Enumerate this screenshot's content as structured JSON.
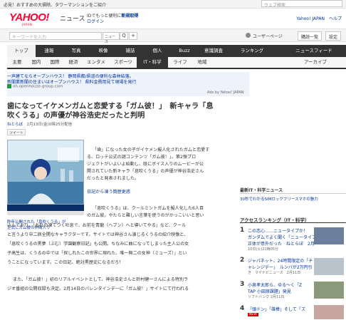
{
  "topbar": {
    "promo": "必見！おすすめの大掃除、タワーマンションをご紹介",
    "search_placeholder": "ウェブ検索"
  },
  "header": {
    "logo": "YAHOO!",
    "logo_sub": "JAPAN",
    "news": "ニュース",
    "login_line1_a": "IDでもっと便利に",
    "login_line1_b": "新規取得",
    "login_line2": "ログイン",
    "right_links": "Yahoo! JAPAN　ヘルプ"
  },
  "searchbar": {
    "keyword_placeholder": "キーワードを入力",
    "category": "ニュース",
    "search_btn": "Q",
    "add_btn": "+",
    "user_page": "ユーザーページ",
    "btn1": "購読一覧",
    "btn2": "設定"
  },
  "nav": {
    "items": [
      "トップ",
      "速報",
      "写真",
      "映像",
      "雑誌",
      "個人",
      "Buzz",
      "意識調査",
      "ランキング",
      "ニュースフィード"
    ]
  },
  "subnav": {
    "items": [
      "主要",
      "国内",
      "国際",
      "経済",
      "エンタメ",
      "スポーツ",
      "IT・科学",
      "ライフ",
      "地域",
      "アーカイブ"
    ]
  },
  "ad": {
    "line1": "一声建てならオープンハウス！ 静岡県都/県道の便利な森林結落。",
    "line2": "新聞業新聞の住まいはオープンハウス！ 県料金費用見て現場を発行",
    "line3": "oh.openhouse-group.com",
    "by": "Ads by Yahoo! JAPAN"
  },
  "article": {
    "title_line1": "歯になってイケメンガムと恋愛する「ガム彼！」　新キャラ「息",
    "title_line2": "吹くうる」の声優が神谷浩史だったと判明",
    "source": "ねとらぼ",
    "date": "2月13日(金)0時25分配信",
    "social_btn": "ツイート",
    "photo_caption1": "昨年公開された「息吹くうる」が",
    "photo_caption2": "正式にガム彼の仲間入り",
    "p1_lines": [
      "「歯」になった女の子がイケメン擬人化されたガムと恋愛す",
      "る、ロッテ公式の謎コンテンツ「ガム彼！」。第2弾プロ",
      "ジェクトがいよいよ始動し、既にボイス入りのムービーが公",
      "開されていた新キャラ「息吹くうる」の声優が神谷浩史さん",
      "だったと発表されました。"
    ],
    "p1_link": "日記から凍う簡歴更惑",
    "p2_lines": [
      "「息吹くうる」は、クールミントガムを擬人化した6人目",
      "のガム彼。やたらと難しい言葉を使うのがかっこいいと思い",
      "込んでおり、「おれの凍てつく吐息で、お前を青龍（ヘブン）へと導いてやる」など、クール",
      "と言うより中二病全開なキャラクターです。サイトでは神谷さん演じるくうるの紹介映像と、",
      "「息吹くうるの黒夢（ぶむ）学園観察日記」も公開。ちなみに曲になってしまった主人公の女",
      "子高生は、くうるの中では「探しれたこの世界に現れた、唯一無二の女神（ミューズ）」とい",
      "うことになっています。この日記、絶対黒歴史になるだろ！"
    ],
    "p3_lines": [
      "また、「ガム彼！」初のリアルイベントとして、神谷浩史さんと鈴村健一さんによる特別ラ",
      "ジオ番組の公開収録も決定。2月14日のバレンタインデーに「ガム彼！」サイトにて行われる"
    ]
  },
  "right": {
    "latest_title": "最新IT・科学ニュース",
    "latest_item": "30秒でわかるSIMロックフリースマホの魅力",
    "ranking_title": "アクセスランキング（IT・科学）",
    "items": [
      {
        "num": "1",
        "lines": [
          "この恋心……ニュータイプか！",
          "ガンダムでよく聞く「ニュータイプ」の",
          "正体が意外だった　ねとらぼ　2月"
        ],
        "sub": "10日(火)21時05分"
      },
      {
        "num": "2",
        "lines": [
          "ジャパネット、24時間限定の「チ",
          "ャレンジデー」　ルンバが2万円引"
        ],
        "sub": "き　マイナビニュース　2月11日"
      },
      {
        "num": "3",
        "lines": [
          "小泉孝太郎ら、ゆる～く「Z",
          "TAP 小田原課題」発見"
        ],
        "sub": "ソフトバンク 2月11日"
      },
      {
        "num": "4",
        "lines": [
          "「頭ドン」「雄棒」そして「ズ"
        ],
        "sub": "NEW"
      }
    ]
  }
}
